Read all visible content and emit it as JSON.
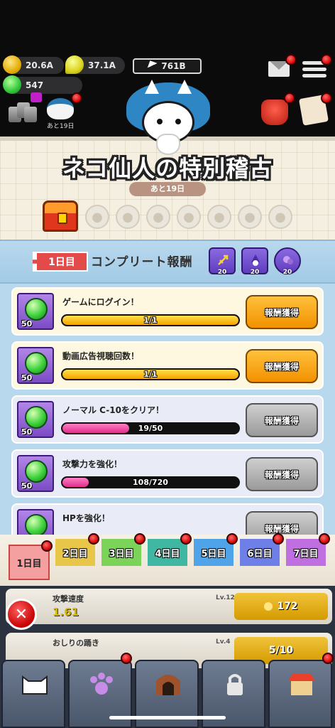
{
  "hud": {
    "money": "20.6A",
    "lemon": "37.1A",
    "gems": "547",
    "energy": "761B",
    "event_days_left": "あと19日"
  },
  "event": {
    "title": "ネコ仙人の特別稽古",
    "days_left": "あと19日",
    "paw_stamps": 7
  },
  "complete": {
    "day_ticket": "1日目",
    "label": "コンプリート報酬",
    "rewards": [
      {
        "icon": "trident-icon",
        "count": "20"
      },
      {
        "icon": "wizard-cat-icon",
        "count": "20"
      },
      {
        "icon": "purple-gem-icon",
        "count": "20"
      }
    ]
  },
  "missions": [
    {
      "label": "ゲームにログイン！",
      "reward": "50",
      "progress_text": "1/1",
      "progress": 1.0,
      "status": "done",
      "button": "報酬獲得"
    },
    {
      "label": "動画広告視聴回数！",
      "reward": "50",
      "progress_text": "1/1",
      "progress": 1.0,
      "status": "done",
      "button": "報酬獲得"
    },
    {
      "label": "ノーマル C-10をクリア！",
      "reward": "50",
      "progress_text": "19/50",
      "progress": 0.38,
      "status": "todo",
      "button": "報酬獲得"
    },
    {
      "label": "攻撃力を強化！",
      "reward": "50",
      "progress_text": "108/720",
      "progress": 0.15,
      "status": "todo",
      "button": "報酬獲得"
    },
    {
      "label": "HPを強化！",
      "reward": "",
      "progress_text": "",
      "progress": 0.0,
      "status": "todo",
      "button": "報酬獲得"
    }
  ],
  "day_tabs": [
    "1日目",
    "2日目",
    "3日目",
    "4日目",
    "5日目",
    "6日目",
    "7日目"
  ],
  "day_tab_colors": [
    "#f4a0a0",
    "#e7c64a",
    "#7bd35a",
    "#3fb7a2",
    "#4fa3e8",
    "#6f7fe8",
    "#c06fe0"
  ],
  "upgrades": [
    {
      "name": "攻撃速度",
      "level": "Lv.12",
      "value": "1.61",
      "cost": "172"
    },
    {
      "name": "おしりの踊き",
      "level": "Lv.4",
      "value": "",
      "cost": "5/10"
    }
  ]
}
